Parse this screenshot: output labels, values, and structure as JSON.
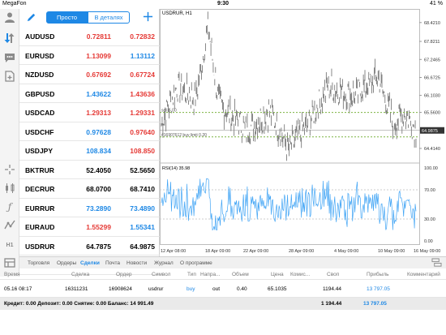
{
  "status": {
    "carrier": "MegaFon",
    "time": "9:30",
    "battery": "41 %"
  },
  "quotes": {
    "tab_simple": "Просто",
    "tab_detail": "В деталях",
    "rows": [
      {
        "symbol": "AUDUSD",
        "bid": "0.72811",
        "ask": "0.72832",
        "bid_color": "red",
        "ask_color": "red"
      },
      {
        "symbol": "EURUSD",
        "bid": "1.13099",
        "ask": "1.13112",
        "bid_color": "red",
        "ask_color": "blue"
      },
      {
        "symbol": "NZDUSD",
        "bid": "0.67692",
        "ask": "0.67724",
        "bid_color": "red",
        "ask_color": "red"
      },
      {
        "symbol": "GBPUSD",
        "bid": "1.43622",
        "ask": "1.43636",
        "bid_color": "blue",
        "ask_color": "red"
      },
      {
        "symbol": "USDCAD",
        "bid": "1.29313",
        "ask": "1.29331",
        "bid_color": "red",
        "ask_color": "red"
      },
      {
        "symbol": "USDCHF",
        "bid": "0.97628",
        "ask": "0.97640",
        "bid_color": "blue",
        "ask_color": "red"
      },
      {
        "symbol": "USDJPY",
        "bid": "108.834",
        "ask": "108.850",
        "bid_color": "blue",
        "ask_color": "red"
      },
      {
        "symbol": "BKTRUR",
        "bid": "52.4050",
        "ask": "52.5650",
        "bid_color": "black",
        "ask_color": "black"
      },
      {
        "symbol": "DECRUR",
        "bid": "68.0700",
        "ask": "68.7410",
        "bid_color": "black",
        "ask_color": "black"
      },
      {
        "symbol": "EURRUR",
        "bid": "73.2890",
        "ask": "73.4890",
        "bid_color": "blue",
        "ask_color": "blue"
      },
      {
        "symbol": "EURAUD",
        "bid": "1.55299",
        "ask": "1.55341",
        "bid_color": "red",
        "ask_color": "blue"
      },
      {
        "symbol": "USDRUR",
        "bid": "64.7875",
        "ask": "64.9875",
        "bid_color": "black",
        "ask_color": "black"
      },
      {
        "symbol": "GBPCAD",
        "bid": "1.85728",
        "ask": "1.85761",
        "bid_color": "red",
        "ask_color": "red"
      }
    ]
  },
  "chart": {
    "title": "USDRUR, H1",
    "sell_label": "sell 5.00",
    "order_label": "#16907612 buy limit 0.20",
    "rsi_label": "RSI(14) 35.98",
    "current_price": "64.9875",
    "price_ticks": [
      "68.4210",
      "67.8211",
      "67.2465",
      "66.6725",
      "66.1030",
      "65.5600",
      "64.9880",
      "64.4140"
    ],
    "rsi_ticks": [
      "100.00",
      "70.00",
      "30.00",
      "0.00"
    ],
    "time_ticks": [
      "12 Apr 08:00",
      "18 Apr 09:00",
      "22 Apr 09:00",
      "28 Apr 09:00",
      "4 May 09:00",
      "10 May 09:00",
      "16 May 09:00"
    ]
  },
  "terminal": {
    "tabs": [
      "Торговля",
      "Ордеры",
      "Сделки",
      "Почта",
      "Новости",
      "Журнал",
      "О программе"
    ],
    "active_tab": "Сделки",
    "headers": [
      "Время",
      "Сделка",
      "Ордер",
      "Символ",
      "Тип",
      "Напра...",
      "Объем",
      "Цена",
      "Комис...",
      "Своп",
      "Прибыль",
      "Комментарий"
    ],
    "deal": {
      "time": "05.16 08:17",
      "deal": "16311231",
      "order": "16908624",
      "symbol": "usdrur",
      "type": "buy",
      "direction": "out",
      "volume": "0.40",
      "price": "65.1035",
      "swap": "1194.44",
      "profit": "13 797.05"
    },
    "summary": {
      "text": "Кредит: 0.00 Депозит: 0.00 Снятие: 0.00 Баланс: 14 991.49",
      "swap": "1 194.44",
      "profit": "13 797.05"
    }
  },
  "colors": {
    "accent": "#1e88e5",
    "up": "#1e88e5",
    "down": "#e53935"
  }
}
